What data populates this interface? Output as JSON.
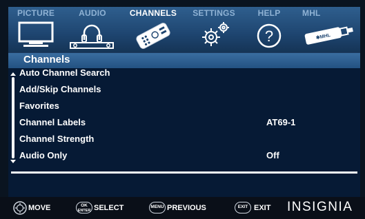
{
  "tabs": [
    {
      "label": "PICTURE",
      "icon": "tv-icon",
      "active": false
    },
    {
      "label": "AUDIO",
      "icon": "headphones-icon",
      "active": false
    },
    {
      "label": "CHANNELS",
      "icon": "remote-icon",
      "active": true
    },
    {
      "label": "SETTINGS",
      "icon": "gears-icon",
      "active": false
    },
    {
      "label": "HELP",
      "icon": "question-icon",
      "active": false
    },
    {
      "label": "MHL",
      "icon": "mhl-cable-icon",
      "active": false
    }
  ],
  "panel": {
    "title": "Channels",
    "items": [
      {
        "label": "Auto Channel Search",
        "value": ""
      },
      {
        "label": "Add/Skip Channels",
        "value": ""
      },
      {
        "label": "Favorites",
        "value": ""
      },
      {
        "label": "Channel Labels",
        "value": "AT69-1"
      },
      {
        "label": "Channel Strength",
        "value": ""
      },
      {
        "label": "Audio Only",
        "value": "Off"
      }
    ]
  },
  "hints": [
    {
      "key": "",
      "label": "MOVE",
      "icon": "dpad-icon"
    },
    {
      "key": "OK ENTER",
      "label": "SELECT",
      "icon": "ok-enter-button"
    },
    {
      "key": "MENU",
      "label": "PREVIOUS",
      "icon": "menu-button"
    },
    {
      "key": "EXIT",
      "label": "EXIT",
      "icon": "exit-button"
    }
  ],
  "brand": "INSIGNIA",
  "colors": {
    "tab_bar": "#1e4570",
    "panel_bg": "#061a35",
    "title_bar": "#245282",
    "active_tab_text": "#ffffff",
    "inactive_tab_text": "#8fb2d4"
  }
}
